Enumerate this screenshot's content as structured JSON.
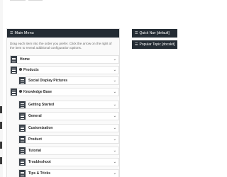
{
  "main_menu": {
    "title": "Main Menu",
    "instructions": "Drag each item into the order you prefer. Click the arrow on the right of the item to reveal additional configuration options.",
    "items": [
      {
        "label": "Home",
        "expandable": false
      },
      {
        "label": "Products",
        "expandable": true
      },
      {
        "label": "Social Display Pictures",
        "expandable": false
      },
      {
        "label": "Knowledge Base",
        "expandable": true
      },
      {
        "label": "Getting Started",
        "expandable": false
      },
      {
        "label": "General",
        "expandable": false
      },
      {
        "label": "Customization",
        "expandable": false
      },
      {
        "label": "Product",
        "expandable": false
      },
      {
        "label": "Tutorial",
        "expandable": false
      },
      {
        "label": "Troubleshoot",
        "expandable": false
      },
      {
        "label": "Tips & Tricks",
        "expandable": false
      }
    ]
  },
  "widgets": [
    {
      "label": "Quick Nav [default]"
    },
    {
      "label": "Popular Topic [docskit]"
    }
  ],
  "icons": {
    "menu": "list-icon",
    "handle": "drag-handle-icon",
    "chevron": "chevron-down-icon",
    "expand": "expand-toggle-icon"
  },
  "colors": {
    "header_bg": "#242c34",
    "handle_bg": "#3a4149",
    "item_bg": "#ffffff",
    "panel_bg": "#fafafa"
  }
}
